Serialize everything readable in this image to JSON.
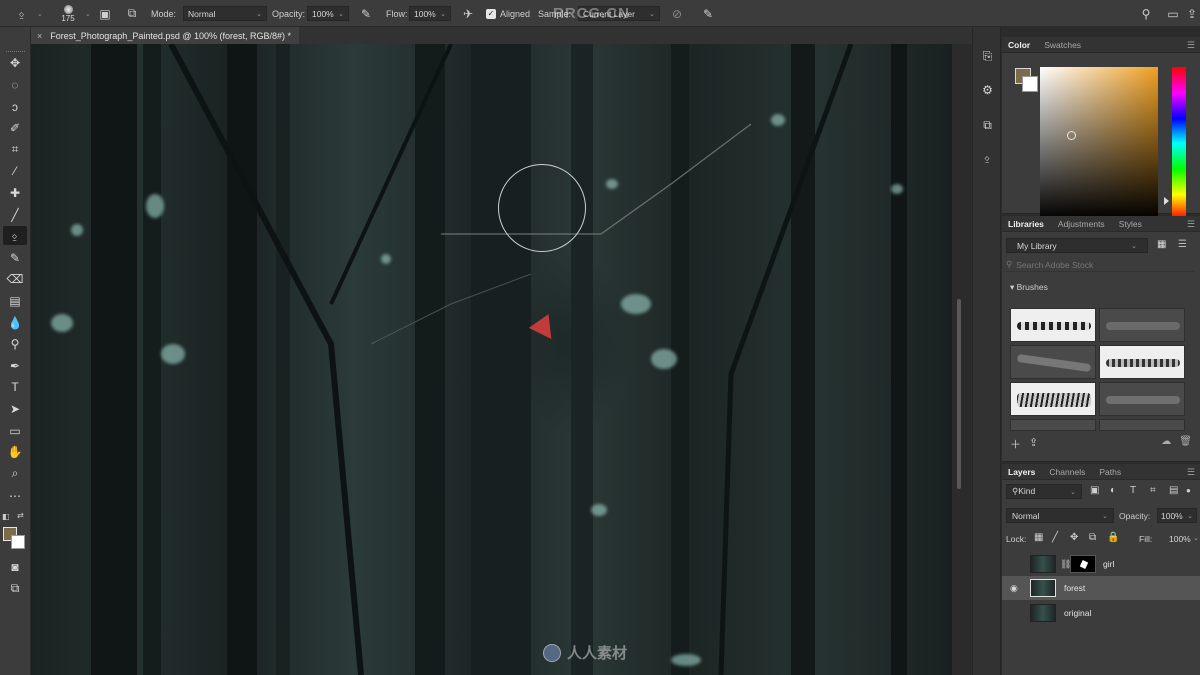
{
  "options_bar": {
    "brush_size": "175",
    "mode_label": "Mode:",
    "mode_value": "Normal",
    "opacity_label": "Opacity:",
    "opacity_value": "100%",
    "flow_label": "Flow:",
    "flow_value": "100%",
    "aligned_label": "Aligned",
    "sample_label": "Sample:",
    "sample_value": "Current Layer",
    "watermark": "RRCG.CN"
  },
  "document": {
    "tab_title": "Forest_Photograph_Painted.psd @ 100% (forest, RGB/8#) *",
    "close_glyph": "×"
  },
  "canvas": {
    "watermark_text": "人人素材"
  },
  "color_panel": {
    "tabs": [
      "Color",
      "Swatches"
    ],
    "foreground_color": "#7b6b4a",
    "background_color": "#ffffff"
  },
  "libraries_panel": {
    "tabs": [
      "Libraries",
      "Adjustments",
      "Styles"
    ],
    "library_name": "My Library",
    "search_placeholder": "Search Adobe Stock",
    "section_title": "Brushes"
  },
  "layers_panel": {
    "tabs": [
      "Layers",
      "Channels",
      "Paths"
    ],
    "filter_kind": "Kind",
    "blend_mode": "Normal",
    "opacity_label": "Opacity:",
    "opacity_value": "100%",
    "lock_label": "Lock:",
    "fill_label": "Fill:",
    "fill_value": "100%",
    "layers": [
      {
        "name": "girl",
        "visible": false,
        "selected": false,
        "has_mask": true
      },
      {
        "name": "forest",
        "visible": true,
        "selected": true,
        "has_mask": false
      },
      {
        "name": "original",
        "visible": false,
        "selected": false,
        "has_mask": false
      }
    ]
  },
  "icons": {
    "menu": "☰",
    "search": "⚲",
    "eye": "◉",
    "chevron": "⌄"
  }
}
